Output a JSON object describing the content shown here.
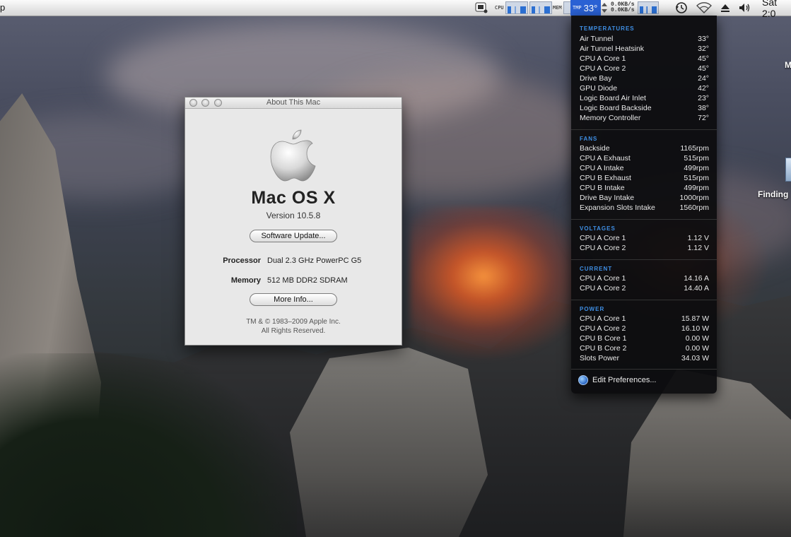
{
  "menubar": {
    "left_fragment": "p",
    "cpu_label": "CPU",
    "mem_label": "MEM",
    "tmp_label": "TMP",
    "temperature": "33°",
    "net_up": "0.0KB/s",
    "net_down": "0.0KB/s",
    "clock": "Sat 2:0"
  },
  "about": {
    "window_title": "About This Mac",
    "os_name": "Mac OS X",
    "version": "Version 10.5.8",
    "software_update": "Software Update...",
    "processor_label": "Processor",
    "processor_value": "Dual 2.3 GHz PowerPC G5",
    "memory_label": "Memory",
    "memory_value": "512 MB DDR2 SDRAM",
    "more_info": "More Info...",
    "copyright": "TM & © 1983–2009 Apple Inc.",
    "rights": "All Rights Reserved."
  },
  "sensors": {
    "temperatures": {
      "title": "TEMPERATURES",
      "rows": [
        {
          "name": "Air Tunnel",
          "value": "33°"
        },
        {
          "name": "Air Tunnel Heatsink",
          "value": "32°"
        },
        {
          "name": "CPU A Core 1",
          "value": "45°"
        },
        {
          "name": "CPU A Core 2",
          "value": "45°"
        },
        {
          "name": "Drive Bay",
          "value": "24°"
        },
        {
          "name": "GPU Diode",
          "value": "42°"
        },
        {
          "name": "Logic Board Air Inlet",
          "value": "23°"
        },
        {
          "name": "Logic Board Backside",
          "value": "38°"
        },
        {
          "name": "Memory Controller",
          "value": "72°"
        }
      ]
    },
    "fans": {
      "title": "FANS",
      "rows": [
        {
          "name": "Backside",
          "value": "1165rpm"
        },
        {
          "name": "CPU A Exhaust",
          "value": "515rpm"
        },
        {
          "name": "CPU A Intake",
          "value": "499rpm"
        },
        {
          "name": "CPU B Exhaust",
          "value": "515rpm"
        },
        {
          "name": "CPU B Intake",
          "value": "499rpm"
        },
        {
          "name": "Drive Bay Intake",
          "value": "1000rpm"
        },
        {
          "name": "Expansion Slots Intake",
          "value": "1560rpm"
        }
      ]
    },
    "voltages": {
      "title": "VOLTAGES",
      "rows": [
        {
          "name": "CPU A Core 1",
          "value": "1.12 V"
        },
        {
          "name": "CPU A Core 2",
          "value": "1.12 V"
        }
      ]
    },
    "current": {
      "title": "CURRENT",
      "rows": [
        {
          "name": "CPU A Core 1",
          "value": "14.16 A"
        },
        {
          "name": "CPU A Core 2",
          "value": "14.40 A"
        }
      ]
    },
    "power": {
      "title": "POWER",
      "rows": [
        {
          "name": "CPU A Core 1",
          "value": "15.87 W"
        },
        {
          "name": "CPU A Core 2",
          "value": "16.10 W"
        },
        {
          "name": "CPU B Core 1",
          "value": "0.00 W"
        },
        {
          "name": "CPU B Core 2",
          "value": "0.00 W"
        },
        {
          "name": "Slots Power",
          "value": "34.03 W"
        }
      ]
    },
    "edit_preferences": "Edit Preferences..."
  },
  "desktop": {
    "icon1_label": "M",
    "icon2_label": "Finding"
  },
  "colors": {
    "menu_accent": "#2a61d4",
    "section_title": "#3f8fe5"
  }
}
